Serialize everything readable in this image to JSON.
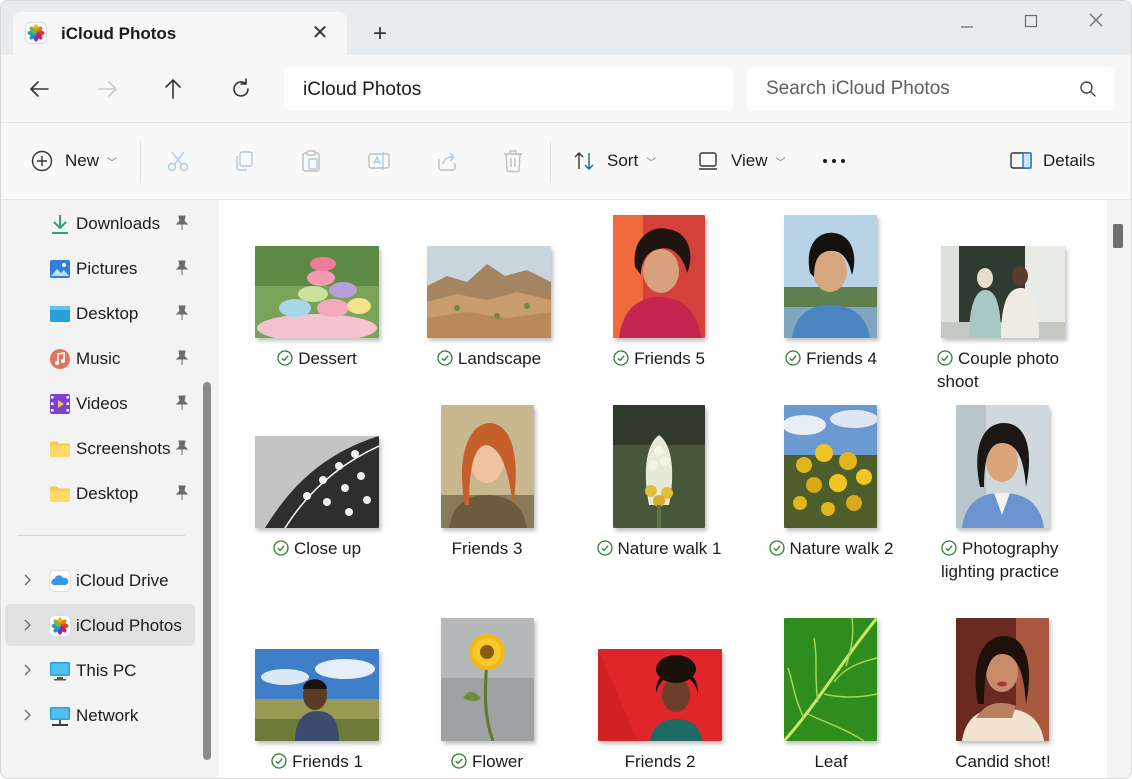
{
  "tab": {
    "title": "iCloud Photos",
    "icon": "photos-app-icon"
  },
  "window_controls": [
    "minimize",
    "maximize",
    "close"
  ],
  "address": {
    "path": "iCloud Photos"
  },
  "search": {
    "placeholder": "Search iCloud Photos"
  },
  "commands": {
    "new": "New",
    "sort": "Sort",
    "view": "View",
    "details": "Details",
    "more": "more-options-icon"
  },
  "sidebar": {
    "quick_access": [
      {
        "label": "Downloads",
        "icon": "download-icon",
        "pinned": true
      },
      {
        "label": "Pictures",
        "icon": "pictures-icon",
        "pinned": true
      },
      {
        "label": "Desktop",
        "icon": "desktop-icon",
        "pinned": true
      },
      {
        "label": "Music",
        "icon": "music-icon",
        "pinned": true
      },
      {
        "label": "Videos",
        "icon": "videos-icon",
        "pinned": true
      },
      {
        "label": "Screenshots",
        "icon": "folder-icon",
        "pinned": true
      },
      {
        "label": "Desktop",
        "icon": "folder-icon",
        "pinned": true
      }
    ],
    "locations": [
      {
        "label": "iCloud Drive",
        "icon": "icloud-drive-icon",
        "selected": false
      },
      {
        "label": "iCloud Photos",
        "icon": "photos-app-icon",
        "selected": true
      },
      {
        "label": "This PC",
        "icon": "this-pc-icon",
        "selected": false
      },
      {
        "label": "Network",
        "icon": "network-icon",
        "selected": false
      }
    ]
  },
  "photos": [
    {
      "name": "Dessert",
      "synced": true
    },
    {
      "name": "Landscape",
      "synced": true
    },
    {
      "name": "Friends 5",
      "synced": true
    },
    {
      "name": "Friends 4",
      "synced": true
    },
    {
      "name": "Couple photo shoot",
      "synced": true
    },
    {
      "name": "Close up",
      "synced": true
    },
    {
      "name": "Friends 3",
      "synced": false
    },
    {
      "name": "Nature walk 1",
      "synced": true
    },
    {
      "name": "Nature walk 2",
      "synced": true
    },
    {
      "name": "Photography lighting practice",
      "synced": true
    },
    {
      "name": "Friends 1",
      "synced": true
    },
    {
      "name": "Flower",
      "synced": true
    },
    {
      "name": "Friends 2",
      "synced": false
    },
    {
      "name": "Leaf",
      "synced": false
    },
    {
      "name": "Candid shot!",
      "synced": false
    }
  ],
  "colors": {
    "accent": "#0067c0",
    "synced_check": "#2e7d32"
  }
}
